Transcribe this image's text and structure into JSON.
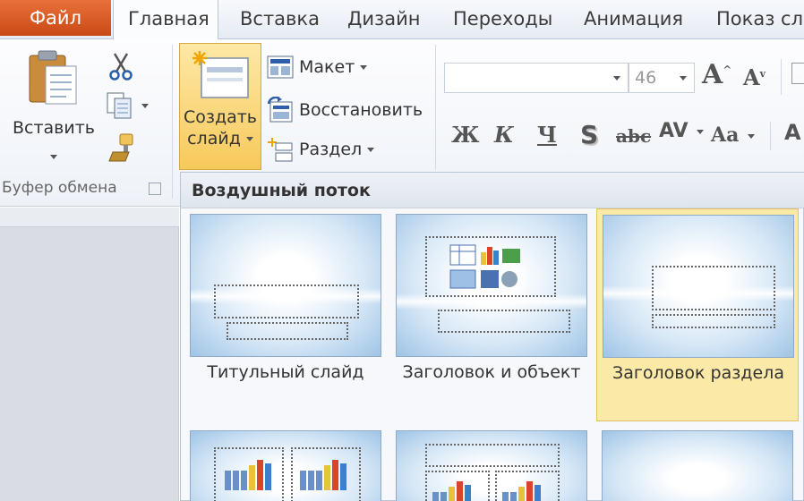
{
  "tabs": {
    "file": "Файл",
    "home": "Главная",
    "insert": "Вставка",
    "design": "Дизайн",
    "transitions": "Переходы",
    "animations": "Анимация",
    "slideshow": "Показ сла"
  },
  "clipboard": {
    "paste_label": "Вставить",
    "group_label": "Буфер обмена"
  },
  "slides": {
    "new_slide_line1": "Создать",
    "new_slide_line2": "слайд",
    "layout_label": "Макет",
    "reset_label": "Восстановить",
    "section_label": "Раздел"
  },
  "font": {
    "name_value": "",
    "size_value": "46",
    "grow_label": "A",
    "shrink_label": "A",
    "bold": "Ж",
    "italic": "К",
    "underline": "Ч",
    "shadow": "S",
    "strike": "abc",
    "spacing": "AV",
    "case": "Aa"
  },
  "gallery": {
    "theme_name": "Воздушный поток",
    "layouts": [
      {
        "label": "Титульный слайд"
      },
      {
        "label": "Заголовок и объект"
      },
      {
        "label": "Заголовок раздела"
      }
    ],
    "selected_index": 2
  },
  "colors": {
    "file_tab": "#d65a22",
    "selected_fill": "#fbe9a8",
    "selected_border": "#e4c164"
  }
}
